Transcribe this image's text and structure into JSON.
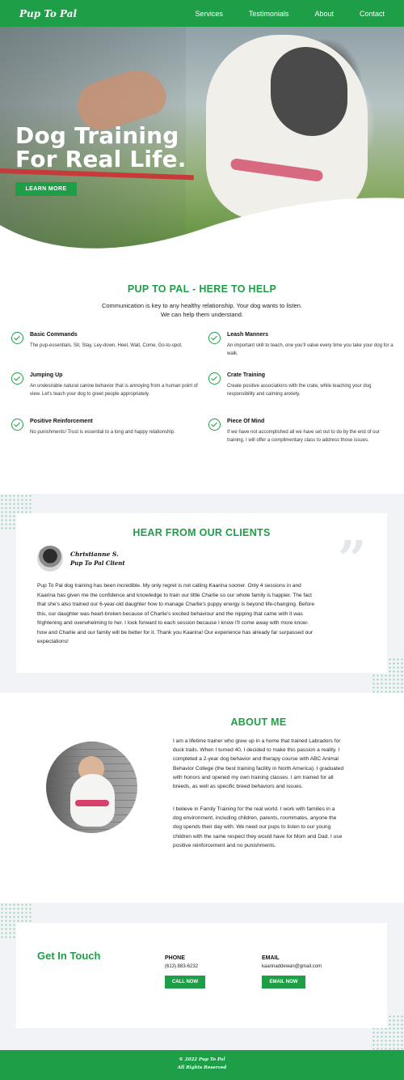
{
  "nav": {
    "logo": "Pup To Pal",
    "links": [
      "Services",
      "Testimonials",
      "About",
      "Contact"
    ]
  },
  "hero": {
    "title_line1": "Dog Training",
    "title_line2": "For Real Life.",
    "button": "LEARN MORE"
  },
  "help": {
    "title": "PUP TO PAL - HERE TO HELP",
    "subtitle_line1": "Communication is key to any healthy relationship. Your dog wants to listen.",
    "subtitle_line2": "We can help them understand.",
    "features": [
      {
        "title": "Basic Commands",
        "desc": "The pup-essentials. Sit, Stay, Ley-down, Heel, Wait, Come, Go-to-spot."
      },
      {
        "title": "Leash Manners",
        "desc": "An important skill to teach, one you'll value every time you take your dog for a walk."
      },
      {
        "title": "Jumping Up",
        "desc": "An undesirable natural canine behavior that is annoying from a human point of view. Let's teach your dog to greet people appropriately."
      },
      {
        "title": "Crate Training",
        "desc": "Create positive associations with the crate, while teaching your dog responsibility and calming anxiety."
      },
      {
        "title": "Positive Reinforcement",
        "desc": "No punishments! Trust is essential to a long and happy relationship."
      },
      {
        "title": "Piece Of Mind",
        "desc": "If we have not accomplished all we have set out to do by the end of our training, I will offer a complimentary class to address those issues."
      }
    ]
  },
  "testimonials": {
    "title": "HEAR FROM OUR CLIENTS",
    "client_name": "Christianne S.",
    "client_role": "Pup To Pal Client",
    "quote_glyph": "”",
    "body": "Pup To Pal dog training has been incredible. My only regret is not calling Kaarina sooner. Only 4 sessions in and Kaarina has given me the confidence and knowledge to train our little Charlie so our whole family is happier. The fact that she's also trained our 6-year-old daughter how to manage Charlie's puppy energy is beyond life-changing. Before this, our daughter was heart-broken because of Charlie's excited behaviour and the nipping that came with it was frightening and overwhelming to her. I look forward to each session because I know I'll come away with more know-how and Charlie and our family will be better for it. Thank you Kaarina! Our experience has already far surpassed our expectations!"
  },
  "about": {
    "title": "ABOUT ME",
    "p1": "I am a lifetime trainer who grew up in a home that trained Labradors for duck trails. When I turned 40, I decided to make this passion a reality. I completed a 2-year dog behavior and therapy course with ABC Animal Behavior College (the best training facility in North America). I graduated with honors and opened my own training classes. I am trained for all breeds, as well as specific breed behaviors and issues.",
    "p2": "I believe in Family Training for the real world. I work with families in a dog environment, including children, parents, roommates, anyone the dog spends their day with. We need our pups to listen to our young children with the same respect they would have for Mom and Dad. I use positive reinforcement and no punishments."
  },
  "contact": {
    "title": "Get In Touch",
    "phone_label": "PHONE",
    "phone": "(613) 883-6232",
    "phone_button": "CALL NOW",
    "email_label": "EMAIL",
    "email": "kaarinaddewan@gmail.com",
    "email_button": "EMAIL NOW"
  },
  "footer": {
    "line1": "© 2022 Pup To Pal",
    "line2": "All Rights Reserved"
  },
  "colors": {
    "brand_green": "#1e9e47",
    "section_gray": "#f2f3f6"
  }
}
